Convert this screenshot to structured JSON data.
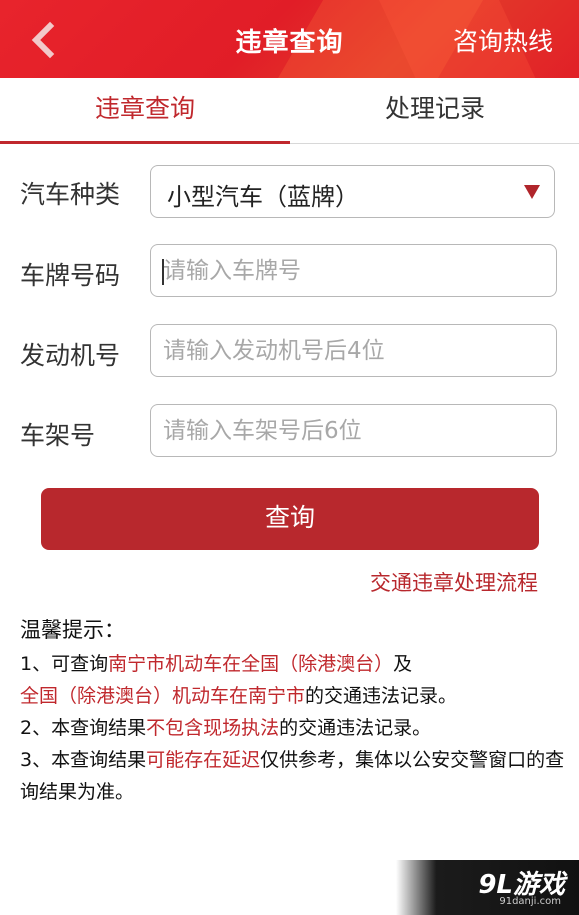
{
  "header": {
    "title": "违章查询",
    "hotline": "咨询热线",
    "back_icon": "chevron-left-icon"
  },
  "tabs": [
    {
      "label": "违章查询",
      "active": true
    },
    {
      "label": "处理记录",
      "active": false
    }
  ],
  "form": {
    "car_type": {
      "label": "汽车种类",
      "value": "小型汽车（蓝牌）"
    },
    "plate": {
      "label": "车牌号码",
      "placeholder": "请输入车牌号"
    },
    "engine": {
      "label": "发动机号",
      "placeholder": "请输入发动机号后4位"
    },
    "frame": {
      "label": "车架号",
      "placeholder": "请输入车架号后6位"
    }
  },
  "query_button": "查询",
  "process_link": "交通违章处理流程",
  "tips": {
    "title": "温馨提示：",
    "line1_a": "1、可查询",
    "line1_b": "南宁市机动车在全国（除港澳台）",
    "line1_c": "及",
    "line1_d": "全国（除港澳台）机动车在南宁市",
    "line1_e": "的交通违法记录。",
    "line2_a": "2、本查询结果",
    "line2_b": "不包含现场执法",
    "line2_c": "的交通违法记录。",
    "line3_a": "3、本查询结果",
    "line3_b": "可能存在延迟",
    "line3_c": "仅供参考，集体以公安交警窗口的查询结果为准。"
  },
  "watermark": {
    "logo": "9L游戏",
    "url": "91danji.com"
  },
  "colors": {
    "brand_red": "#e11d27",
    "accent_red": "#b8282d"
  }
}
